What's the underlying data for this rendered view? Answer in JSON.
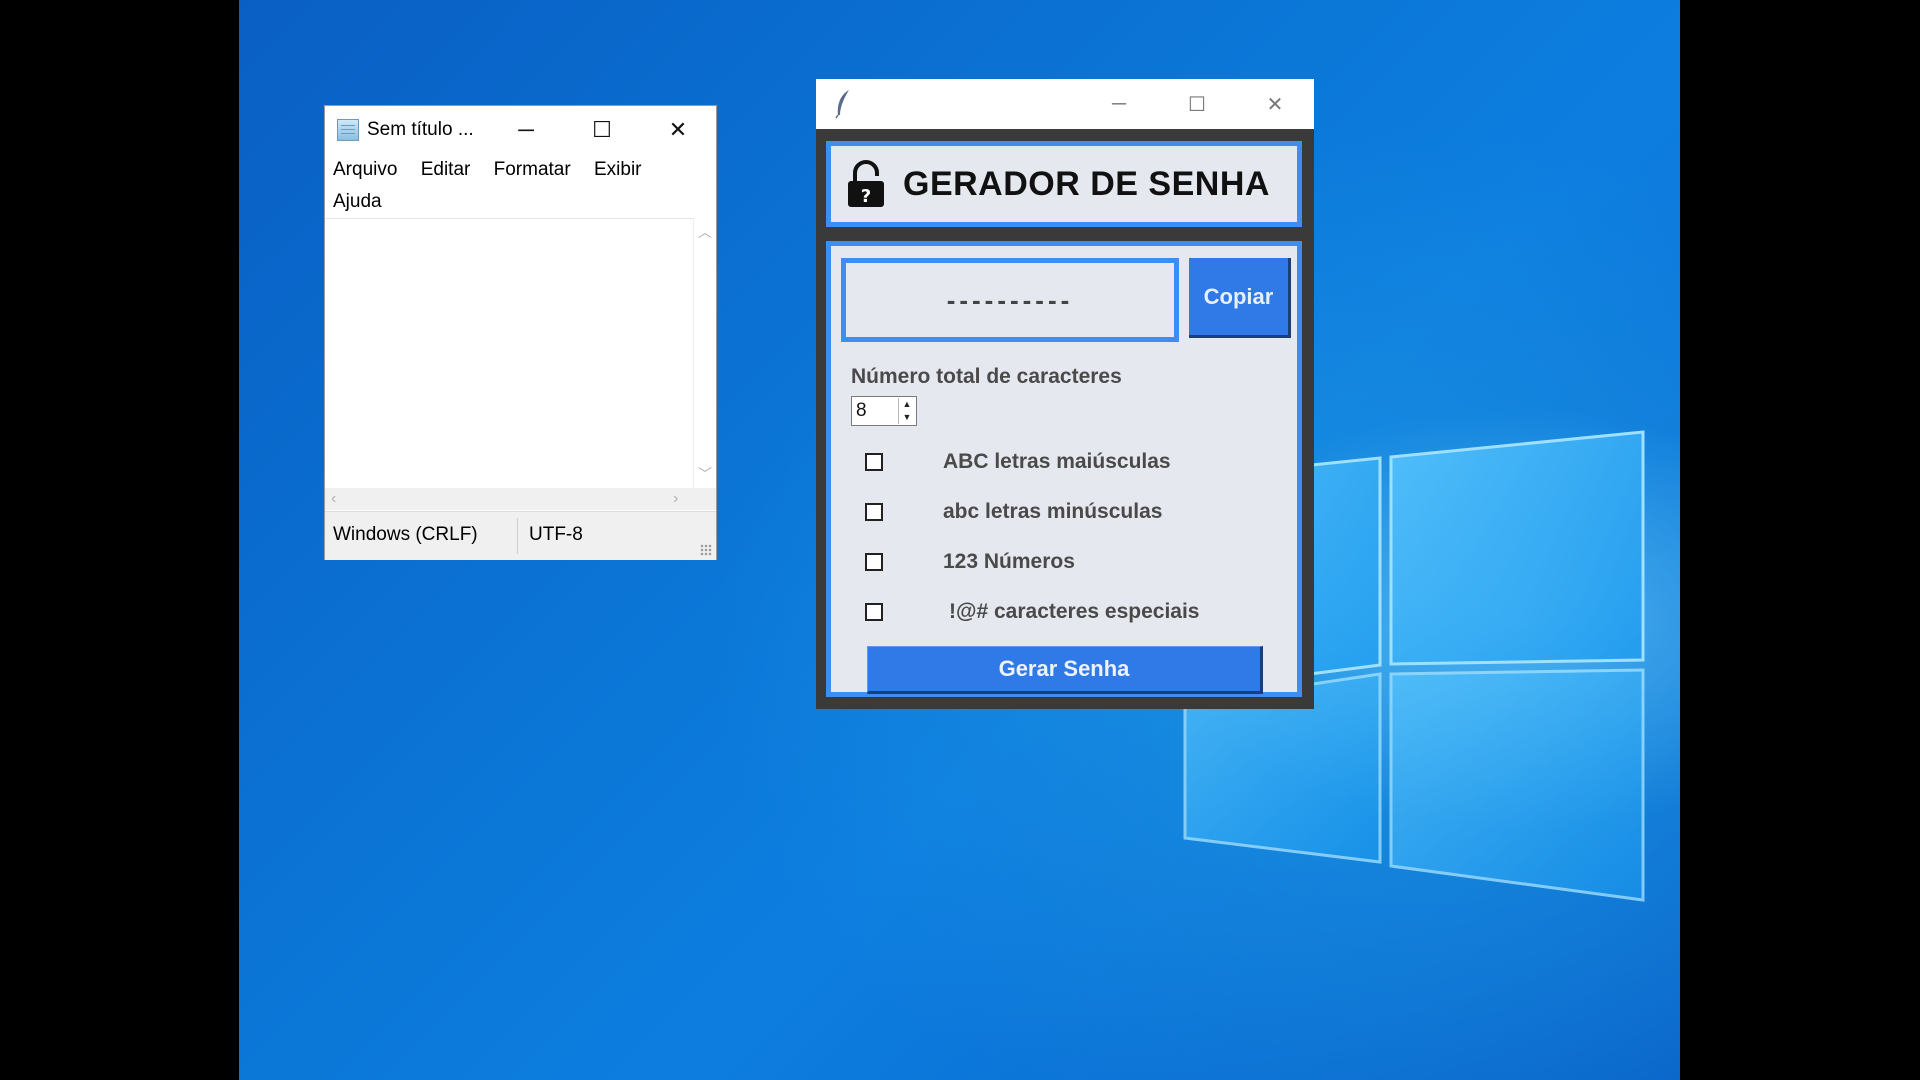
{
  "notepad": {
    "title": "Sem título ...",
    "controls": {
      "minimize": "─",
      "maximize": "☐",
      "close": "✕"
    },
    "menu": [
      "Arquivo",
      "Editar",
      "Formatar",
      "Exibir",
      "Ajuda"
    ],
    "content": "",
    "status": {
      "line_endings": "Windows (CRLF)",
      "encoding": "UTF-8"
    }
  },
  "generator": {
    "controls": {
      "minimize": "─",
      "maximize": "☐",
      "close": "✕"
    },
    "title": "GERADOR DE SENHA",
    "password_display": "----------",
    "copy_label": "Copiar",
    "count_label": "Número total de caracteres",
    "count_value": "8",
    "options": [
      {
        "label": "ABC letras maiúsculas",
        "checked": false
      },
      {
        "label": "abc letras minúsculas",
        "checked": false
      },
      {
        "label": "123 Números",
        "checked": false
      },
      {
        "label": "!@# caracteres especiais",
        "checked": false
      }
    ],
    "generate_label": "Gerar Senha"
  },
  "colors": {
    "accent_blue": "#3d8ef0",
    "button_blue": "#2f7ae6",
    "panel_bg": "#e5e8ef",
    "frame_dark": "#3a3a3a"
  }
}
